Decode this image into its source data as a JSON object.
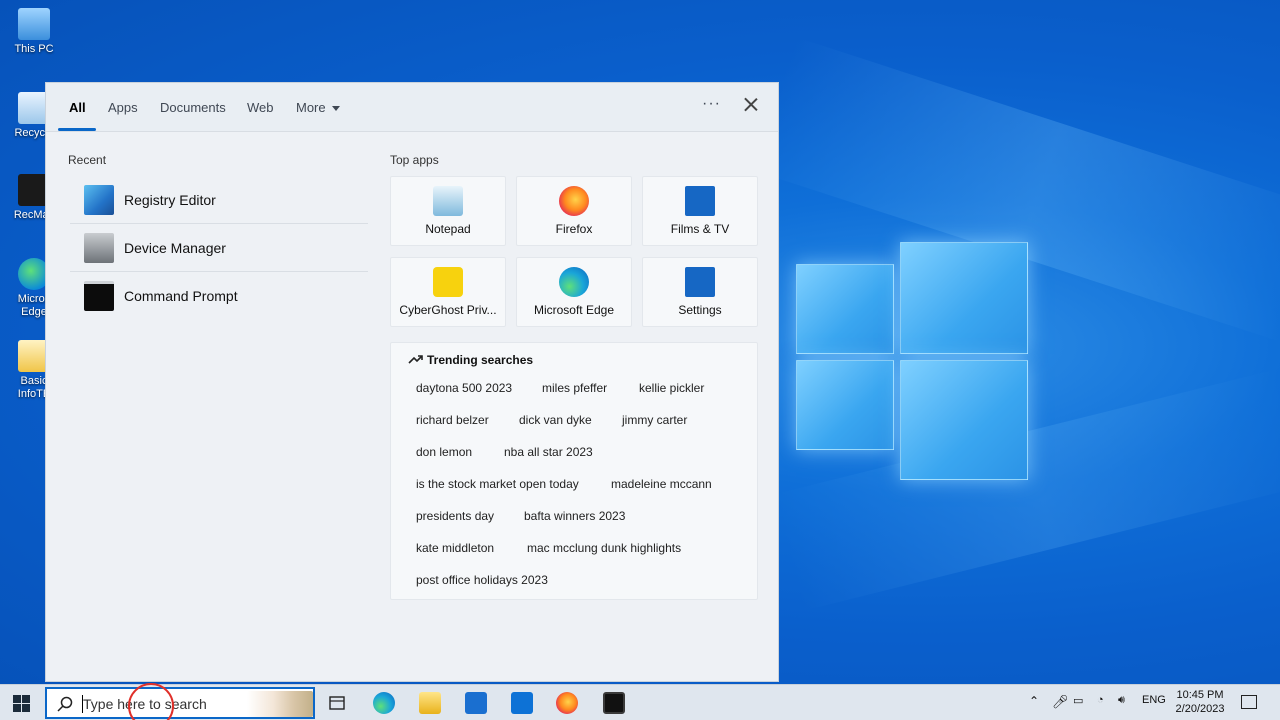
{
  "desktop": {
    "icons": [
      {
        "label": "This PC",
        "icon": "computer-icon"
      },
      {
        "label": "Recycle",
        "icon": "recycle-bin-icon"
      },
      {
        "label": "RecMas",
        "icon": "recmaster-icon"
      },
      {
        "label": "Micros Edge",
        "icon": "edge-icon"
      },
      {
        "label": "Basic InfoTE",
        "icon": "folder-icon"
      }
    ]
  },
  "search_panel": {
    "tabs": [
      {
        "label": "All",
        "active": true
      },
      {
        "label": "Apps"
      },
      {
        "label": "Documents"
      },
      {
        "label": "Web"
      },
      {
        "label": "More"
      }
    ],
    "options_label": "···",
    "recent": {
      "title": "Recent",
      "items": [
        {
          "label": "Registry Editor",
          "icon": "registry-editor-icon"
        },
        {
          "label": "Device Manager",
          "icon": "device-manager-icon"
        },
        {
          "label": "Command Prompt",
          "icon": "command-prompt-icon"
        }
      ]
    },
    "top_apps": {
      "title": "Top apps",
      "items": [
        {
          "label": "Notepad",
          "icon": "notepad-icon"
        },
        {
          "label": "Firefox",
          "icon": "firefox-icon"
        },
        {
          "label": "Films & TV",
          "icon": "films-tv-icon"
        },
        {
          "label": "CyberGhost Priv...",
          "icon": "cyberghost-icon"
        },
        {
          "label": "Microsoft Edge",
          "icon": "edge-icon"
        },
        {
          "label": "Settings",
          "icon": "settings-gear-icon"
        }
      ]
    },
    "trending": {
      "title": "Trending searches",
      "rows": [
        [
          "daytona 500 2023",
          "miles pfeffer",
          "kellie pickler"
        ],
        [
          "richard belzer",
          "dick van dyke",
          "jimmy carter"
        ],
        [
          "don lemon",
          "nba all star 2023"
        ],
        [
          "is the stock market open today",
          "madeleine mccann"
        ],
        [
          "presidents day",
          "bafta winners 2023"
        ],
        [
          "kate middleton",
          "mac mcclung dunk highlights"
        ],
        [
          "post office holidays 2023"
        ]
      ]
    }
  },
  "taskbar": {
    "search_placeholder": "Type here to search",
    "pinned": [
      "task-view-icon",
      "edge-icon",
      "file-explorer-icon",
      "store-icon",
      "mail-icon",
      "firefox-icon",
      "recorder-icon"
    ],
    "tray": {
      "language": "ENG",
      "time": "10:45 PM",
      "date": "2/20/2023"
    }
  },
  "colors": {
    "accent": "#0a67c8",
    "desktop_blue": "#0a5fcc",
    "panel_bg": "#eef1f5",
    "taskbar_bg": "#dfe6ee"
  }
}
